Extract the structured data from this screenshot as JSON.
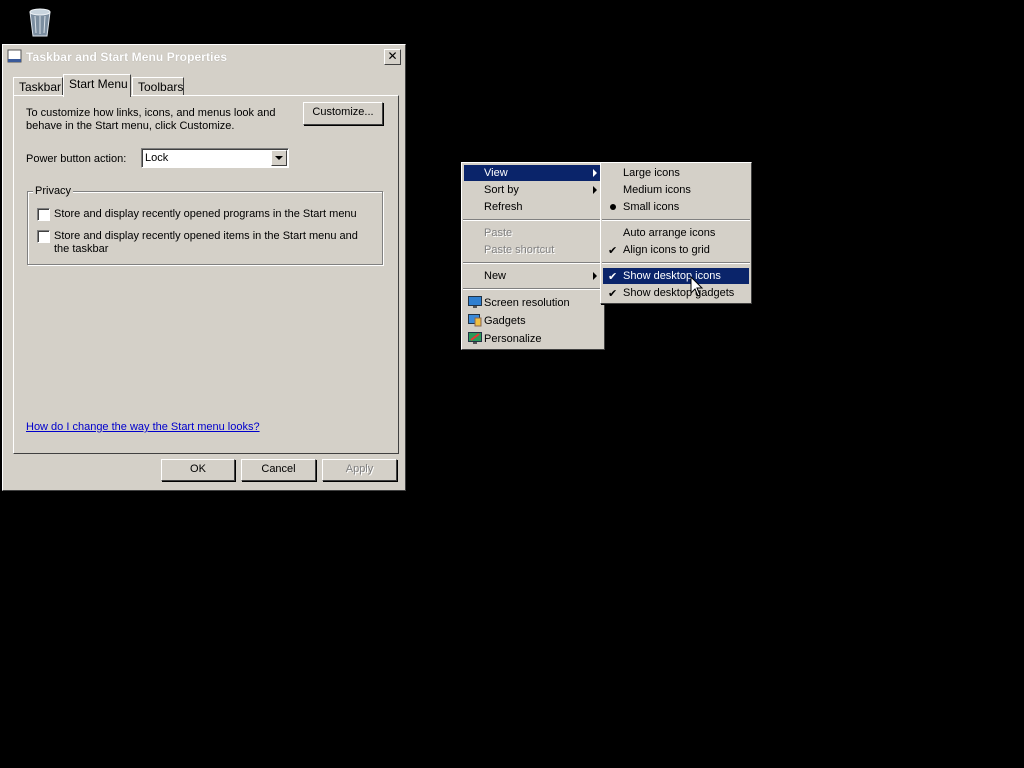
{
  "dialog": {
    "title": "Taskbar and Start Menu Properties",
    "close_label": "✕",
    "tabs": [
      {
        "label": "Taskbar",
        "active": false
      },
      {
        "label": "Start Menu",
        "active": true
      },
      {
        "label": "Toolbars",
        "active": false
      }
    ],
    "description": "To customize how links, icons, and menus look and behave in the Start menu, click Customize.",
    "customize_label": "Customize...",
    "power_button_label": "Power button action:",
    "power_button_value": "Lock",
    "privacy": {
      "label": "Privacy",
      "options": [
        {
          "label": "Store and display recently opened programs in the Start menu",
          "checked": false
        },
        {
          "label": "Store and display recently opened items in the Start menu and the taskbar",
          "checked": false
        }
      ]
    },
    "help_link": "How do I change the way the Start menu looks?",
    "buttons": {
      "ok": "OK",
      "cancel": "Cancel",
      "apply": "Apply"
    }
  },
  "context_menu": {
    "items": {
      "view": "View",
      "sort_by": "Sort by",
      "refresh": "Refresh",
      "paste": "Paste",
      "paste_shortcut": "Paste shortcut",
      "new": "New",
      "screen_resolution": "Screen resolution",
      "gadgets": "Gadgets",
      "personalize": "Personalize"
    }
  },
  "view_submenu": {
    "items": {
      "large_icons": "Large icons",
      "medium_icons": "Medium icons",
      "small_icons": "Small icons",
      "auto_arrange": "Auto arrange icons",
      "align_to_grid": "Align icons to grid",
      "show_desktop_icons": "Show desktop icons",
      "show_desktop_gadgets": "Show desktop gadgets"
    },
    "check_glyph": "✔"
  },
  "colors": {
    "highlight": "#0a246a",
    "face": "#d4d0c8",
    "link": "#0000cc"
  }
}
